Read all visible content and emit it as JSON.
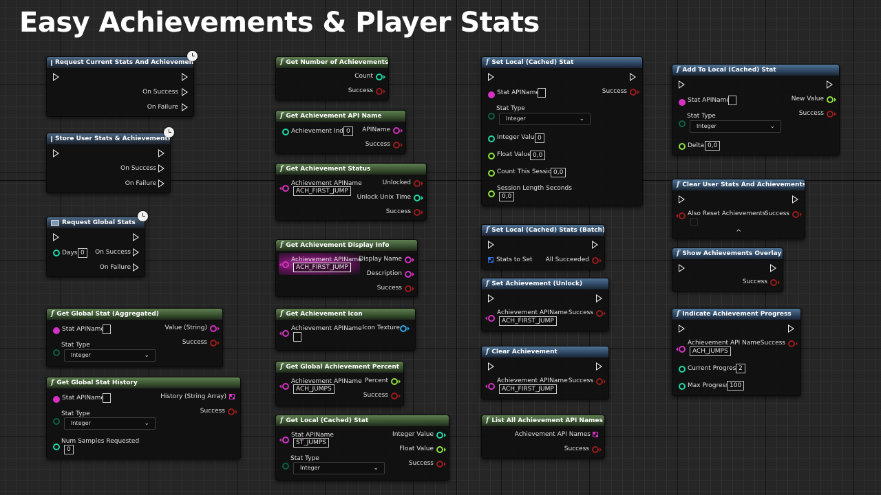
{
  "page_title": "Easy Achievements & Player Stats",
  "nodes": {
    "request_current": {
      "title": "Request Current Stats And Achievements",
      "on_success": "On Success",
      "on_failure": "On Failure"
    },
    "store_user": {
      "title": "Store User Stats & Achievements",
      "on_success": "On Success",
      "on_failure": "On Failure"
    },
    "request_global": {
      "title": "Request Global Stats",
      "days_label": "Days",
      "days_value": "0",
      "on_success": "On Success",
      "on_failure": "On Failure"
    },
    "get_global_stat": {
      "title": "Get Global Stat (Aggregated)",
      "stat_apiname": "Stat APIName",
      "stat_type": "Stat Type",
      "stat_type_value": "Integer",
      "value_string": "Value (String)",
      "success": "Success"
    },
    "get_global_stat_history": {
      "title": "Get Global Stat History",
      "stat_apiname": "Stat APIName",
      "stat_type": "Stat Type",
      "stat_type_value": "Integer",
      "history": "History (String Array)",
      "success": "Success",
      "num_samples": "Num Samples Requested",
      "num_samples_value": "0"
    },
    "get_number": {
      "title": "Get Number of Achievements",
      "count": "Count",
      "success": "Success"
    },
    "get_api_name": {
      "title": "Get Achievement API Name",
      "index_label": "Achievement Index",
      "index_value": "0",
      "apiname": "APIName",
      "success": "Success"
    },
    "get_status": {
      "title": "Get Achievement Status",
      "apiname_label": "Achievement APIName",
      "apiname_value": "ACH_FIRST_JUMP",
      "unlocked": "Unlocked",
      "unlock_time": "Unlock Unix Time",
      "success": "Success"
    },
    "get_display_info": {
      "title": "Get Achievement Display Info",
      "apiname_label": "Achievement APIName",
      "apiname_value": "ACH_FIRST_JUMP",
      "display_name": "Display Name",
      "description": "Description",
      "success": "Success"
    },
    "get_icon": {
      "title": "Get Achievement Icon",
      "apiname_label": "Achievement APIName",
      "icon_texture": "Icon Texture"
    },
    "get_global_percent": {
      "title": "Get Global Achievement Percent",
      "apiname_label": "Achievement APIName",
      "apiname_value": "ACH_JUMPS",
      "percent": "Percent",
      "success": "Success"
    },
    "get_local_stat": {
      "title": "Get Local (Cached) Stat",
      "stat_apiname": "Stat APIName",
      "stat_apiname_value": "ST_JUMPS",
      "stat_type": "Stat Type",
      "stat_type_value": "Integer",
      "integer_value": "Integer Value",
      "float_value": "Float Value",
      "success": "Success"
    },
    "set_local_stat": {
      "title": "Set Local (Cached) Stat",
      "stat_apiname": "Stat APIName",
      "success": "Success",
      "stat_type": "Stat Type",
      "stat_type_value": "Integer",
      "integer_value": "Integer Value",
      "integer_value_v": "0",
      "float_value": "Float Value",
      "float_value_v": "0,0",
      "count_session": "Count This Session",
      "count_session_v": "0,0",
      "session_length": "Session Length Seconds",
      "session_length_v": "0,0"
    },
    "set_local_batch": {
      "title": "Set Local (Cached) Stats (Batch)",
      "stats_to_set": "Stats to Set",
      "all_succeeded": "All Succeeded"
    },
    "set_achievement": {
      "title": "Set Achievement (Unlock)",
      "apiname_label": "Achievement APIName",
      "apiname_value": "ACH_FIRST_JUMP",
      "success": "Success"
    },
    "clear_achievement": {
      "title": "Clear Achievement",
      "apiname_label": "Achievement APIName",
      "apiname_value": "ACH_FIRST_JUMP",
      "success": "Success"
    },
    "list_all": {
      "title": "List All Achievement API Names",
      "names": "Achievement API Names",
      "success": "Success"
    },
    "add_local_stat": {
      "title": "Add To Local (Cached) Stat",
      "stat_apiname": "Stat APIName",
      "new_value": "New Value",
      "stat_type": "Stat Type",
      "stat_type_value": "Integer",
      "success": "Success",
      "delta": "Delta",
      "delta_value": "0,0"
    },
    "clear_user": {
      "title": "Clear User Stats And Achievements",
      "also_reset": "Also Reset Achievements",
      "success": "Success"
    },
    "show_overlay": {
      "title": "Show Achievements Overlay",
      "success": "Success"
    },
    "indicate_progress": {
      "title": "Indicate Achievement Progress",
      "apiname_label": "Achievement API Name",
      "apiname_value": "ACH_JUMPS",
      "success": "Success",
      "current_progress": "Current Progress",
      "current_progress_v": "2",
      "max_progress": "Max Progress",
      "max_progress_v": "100"
    }
  }
}
